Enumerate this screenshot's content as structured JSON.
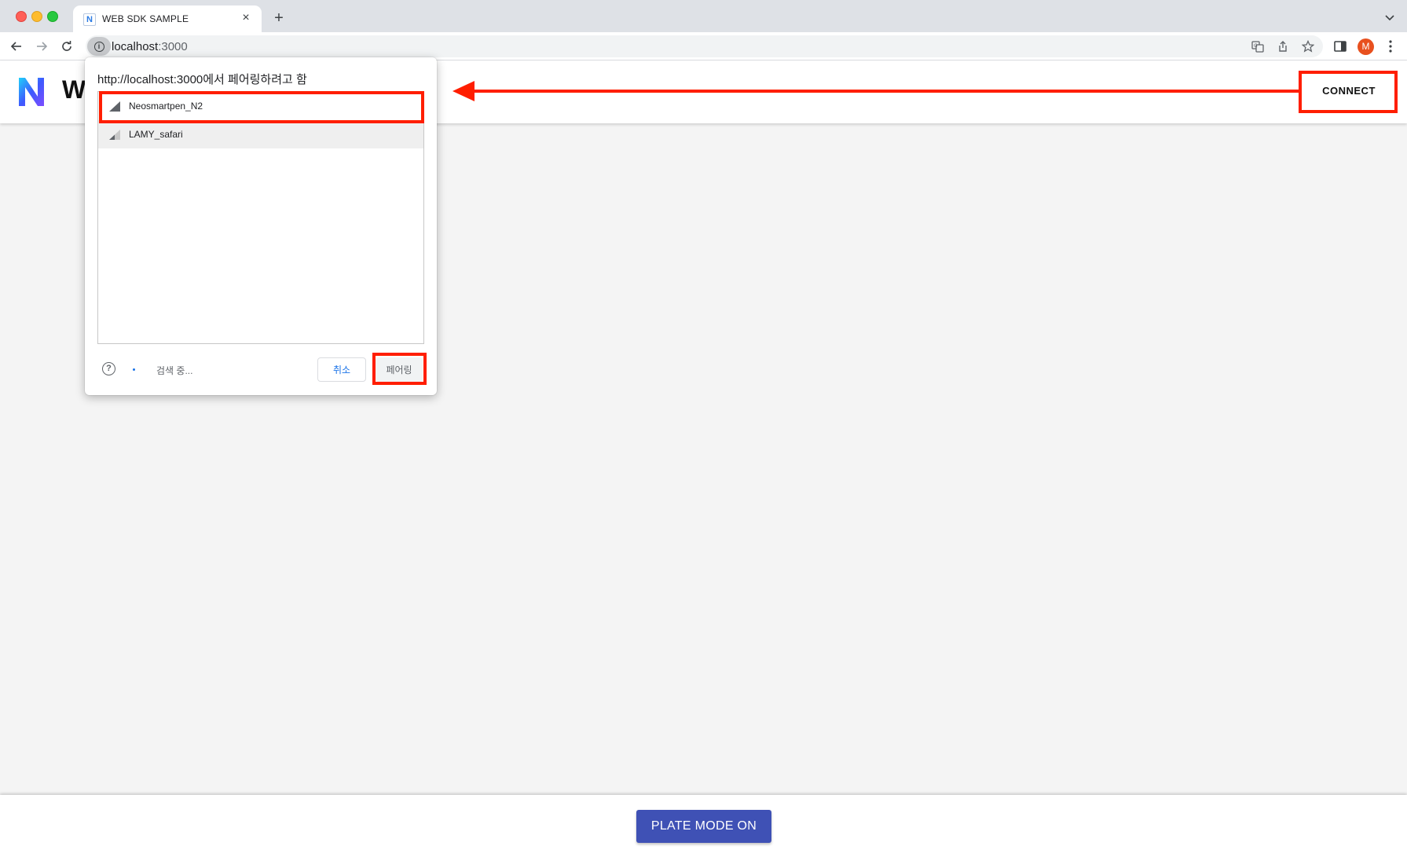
{
  "browser": {
    "tab": {
      "favicon_letter": "N",
      "title": "WEB SDK SAMPLE",
      "close_glyph": "×"
    },
    "new_tab_glyph": "+",
    "address": {
      "host": "localhost",
      "port": ":3000"
    },
    "profile_initial": "M",
    "icons": [
      "back-arrow-icon",
      "forward-arrow-icon",
      "reload-icon",
      "info-icon",
      "translate-icon",
      "share-icon",
      "star-icon",
      "side-panel-icon",
      "kebab-menu-icon",
      "tab-search-chevron-icon"
    ]
  },
  "app": {
    "title_visible": "W",
    "connect_label": "CONNECT",
    "plate_mode_label": "PLATE MODE ON",
    "accent_color": "#3f51b5",
    "logo_colors": [
      "#1fd1f9",
      "#3d5afe",
      "#7c4dff"
    ]
  },
  "pairing_dialog": {
    "title": "http://localhost:3000에서 페어링하려고 함",
    "devices": [
      {
        "name": "Neosmartpen_N2",
        "signal_icon": "signal-strong-icon"
      },
      {
        "name": "LAMY_safari",
        "signal_icon": "signal-weak-icon"
      }
    ],
    "status": "검색 중...",
    "help_glyph": "?",
    "cancel_label": "취소",
    "pair_label": "페어링"
  },
  "annotations": {
    "color": "#ff1e00",
    "highlighted": [
      "connect-button",
      "device-neosmartpen",
      "pair-button"
    ],
    "arrow_direction": "left"
  }
}
